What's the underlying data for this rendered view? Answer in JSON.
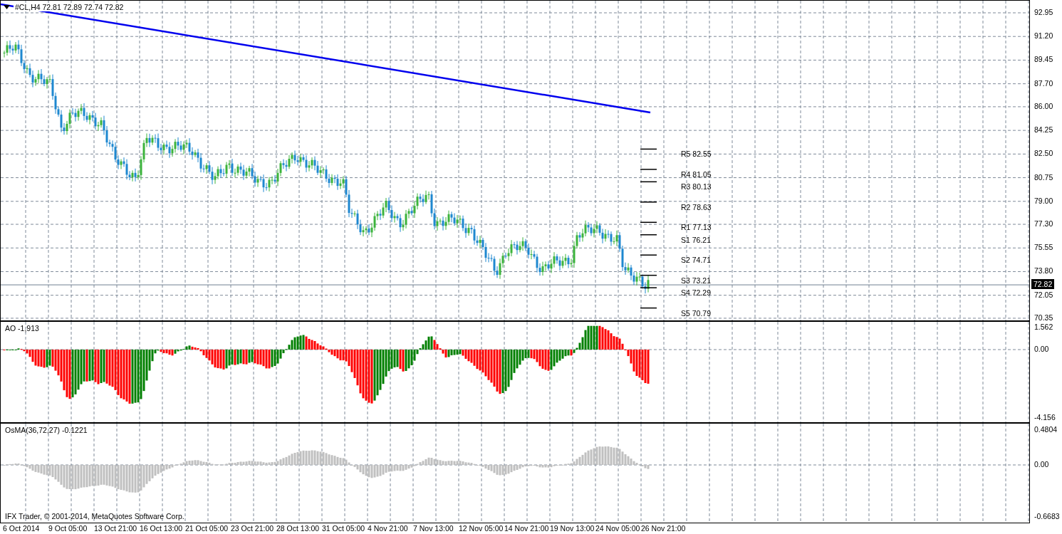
{
  "main_chart": {
    "legend": "#CL,H4  72.81 72.89 72.74 72.82",
    "price_axis": [
      "92.95",
      "91.20",
      "89.45",
      "87.70",
      "86.00",
      "84.25",
      "82.50",
      "80.75",
      "79.00",
      "77.30",
      "75.55",
      "73.80",
      "72.05",
      "70.35"
    ],
    "current_price": "72.82",
    "pivots": [
      {
        "label": "R5 82.55"
      },
      {
        "label": "R4 81.05"
      },
      {
        "label": "R3 80.13"
      },
      {
        "label": "R2 78.63"
      },
      {
        "label": "R1 77.13"
      },
      {
        "label": "S1 76.21"
      },
      {
        "label": "S2 74.71"
      },
      {
        "label": "S3 73.21"
      },
      {
        "label": "S4 72.29"
      },
      {
        "label": "S5 70.79"
      }
    ]
  },
  "ao_panel": {
    "legend": "AO -1,913",
    "axis": [
      "1.562",
      "0.00",
      "-4.156"
    ]
  },
  "osma_panel": {
    "legend": "OsMA(36,72,27) -0.1221",
    "axis": [
      "0.4804",
      "0.00",
      "-0.6683"
    ],
    "footer": "IFX Trader, © 2001-2014, MetaQuotes Software Corp."
  },
  "time_axis": [
    "6 Oct 2014",
    "9 Oct 05:00",
    "13 Oct 21:00",
    "16 Oct 13:00",
    "21 Oct 05:00",
    "23 Oct 21:00",
    "28 Oct 13:00",
    "31 Oct 05:00",
    "4 Nov 21:00",
    "7 Nov 13:00",
    "12 Nov 05:00",
    "14 Nov 21:00",
    "19 Nov 13:00",
    "24 Nov 05:00",
    "26 Nov 21:00"
  ]
}
